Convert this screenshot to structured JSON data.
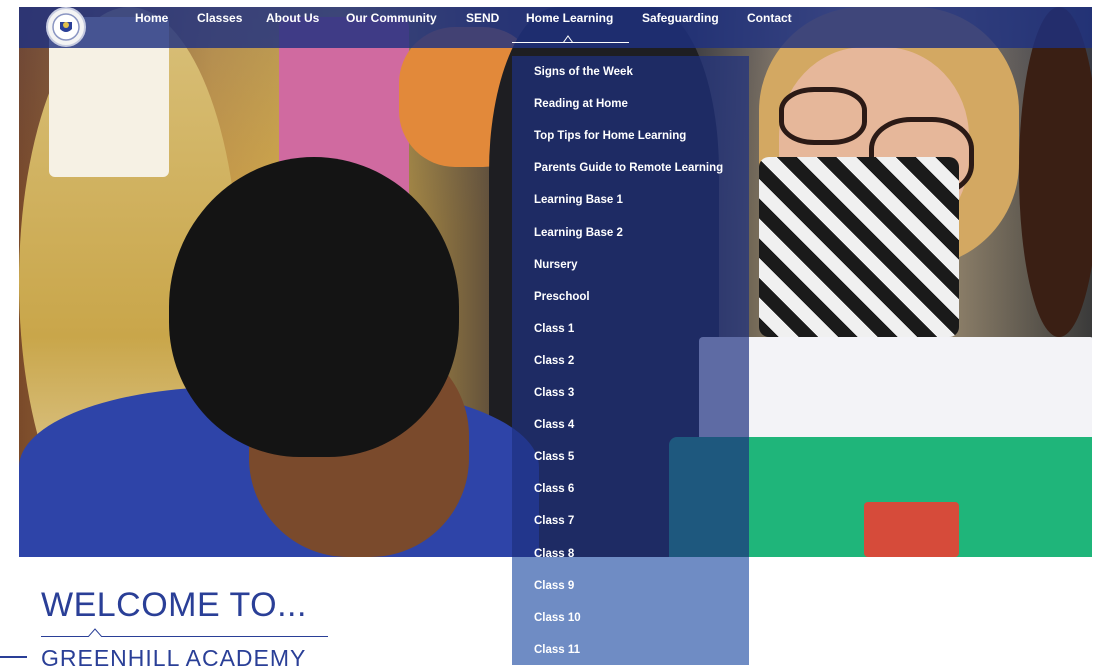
{
  "nav": {
    "logo_name": "school-crest",
    "items": [
      {
        "label": "Home"
      },
      {
        "label": "Classes"
      },
      {
        "label": "About Us"
      },
      {
        "label": "Our Community"
      },
      {
        "label": "SEND"
      },
      {
        "label": "Home Learning"
      },
      {
        "label": "Safeguarding"
      },
      {
        "label": "Contact"
      }
    ],
    "active_item": "Home Learning"
  },
  "dropdown": {
    "items": [
      {
        "label": "Signs of the Week"
      },
      {
        "label": "Reading at Home"
      },
      {
        "label": "Top Tips for Home Learning"
      },
      {
        "label": "Parents Guide to Remote Learning"
      },
      {
        "label": "Learning Base 1"
      },
      {
        "label": "Learning Base 2"
      },
      {
        "label": "Nursery"
      },
      {
        "label": "Preschool"
      },
      {
        "label": "Class 1"
      },
      {
        "label": "Class 2"
      },
      {
        "label": "Class 3"
      },
      {
        "label": "Class 4"
      },
      {
        "label": "Class 5"
      },
      {
        "label": "Class 6"
      },
      {
        "label": "Class 7"
      },
      {
        "label": "Class 8"
      },
      {
        "label": "Class 9"
      },
      {
        "label": "Class 10"
      },
      {
        "label": "Class 11"
      }
    ]
  },
  "welcome": {
    "title": "WELCOME TO...",
    "subtitle": "GREENHILL ACADEMY"
  },
  "colors": {
    "brand_blue": "#1e3180",
    "heading_blue": "#2a3f97",
    "dropdown_light": "#6f8cc4"
  }
}
